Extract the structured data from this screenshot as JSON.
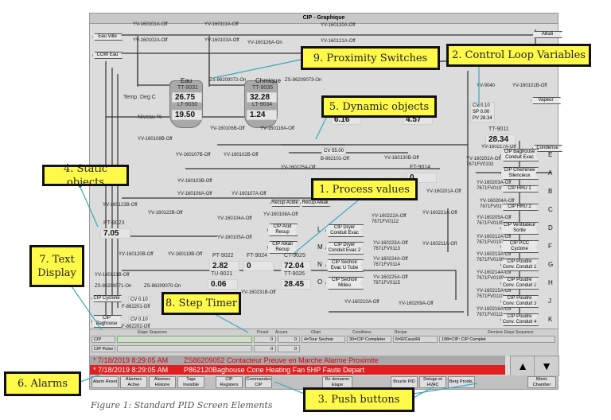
{
  "window": {
    "title": "CIP - Graphique"
  },
  "pipe_labels": [
    "Eau Ville",
    "COW Eau",
    "Alkali",
    "Vapeur",
    "Condense",
    "Recup Acide",
    "Recup Alkali",
    "CIP Acid Recup",
    "CIP Alkali Recup",
    "CIP Cyclone",
    "CIP Baghouse"
  ],
  "tanks": [
    {
      "name": "Eau",
      "temp_tag": "TT-9031",
      "temp": "26.75",
      "level_tag": "LT-9030",
      "level": "19.50"
    },
    {
      "name": "Chmique",
      "temp_tag": "TT-9035",
      "temp": "32.28",
      "level_tag": "LT-9034",
      "level": "1.24"
    }
  ],
  "tank_labels": {
    "temp": "Temp. Deg C",
    "level": "Niveau %"
  },
  "tags": [
    "YV-160101A-Off",
    "YV-160102A-Off",
    "YV-160111A-Off",
    "YV-160103A-Off",
    "YV-160126A-On",
    "YV-160120A-Off",
    "YV-160121A-Off",
    "ZS-86209072-On",
    "ZS-86209073-On",
    "YV-160106B-Off",
    "YV-160116A-Off",
    "YV-160108B-Off",
    "YV-160107B-Off",
    "YV-160102B-Off",
    "YV-160125A-Off",
    "B-862101-Off",
    "YV-160130B-Off",
    "YV-9040",
    "YV-160101B-Off",
    "YV-160217A-Off",
    "YV-160103B-Off",
    "YV-160106A-Off",
    "YV-160107A-Off",
    "YV-160123B-Off",
    "YV-160122B-Off",
    "YV-160108A-Off",
    "YV-160104A-Off",
    "YV-160105A-Off",
    "YV-160201A-Off",
    "YV-160221A-Off",
    "YV-160211A-Off",
    "YV-160120B-Off",
    "YV-160119B-Off",
    "YV-160231B-Off",
    "YV-160121B-Off",
    "ZS-86209071-On",
    "ZS-86209070-On",
    "F-862201-Off",
    "F-862202-Off",
    "YV-160210A-Off",
    "YV-160209A-Off",
    "YV-160222A-Off 7671FV0112",
    "YV-160223A-Off 7671FV0113",
    "YV-160224A-Off 7671FV0114",
    "YV-160225A-Off 7671FV0115",
    "YV-160202A-Off 7671FV0102",
    "YV-160203A-Off 7671FV0103",
    "YV-160204A-Off 7671FV0104",
    "YV-160205A-Off 7671FV0105",
    "YV-160212A-Off 7671FV0107",
    "YV-160213A-Off 7671FV0108",
    "YV-160214A-Off 7671FV0109",
    "YV-160215A-Off 7671FV0110",
    "YV-160216A-Off 7671FV0111"
  ],
  "process_values": [
    {
      "tag": "PT-9012",
      "value": "6.16"
    },
    {
      "tag": "PT-9013",
      "value": "4.57"
    },
    {
      "tag": "FT-9014",
      "value": "0"
    },
    {
      "tag": "TT-9011",
      "value": "28.34"
    },
    {
      "tag": "PT-9023",
      "value": "7.05"
    },
    {
      "tag": "PT-9022",
      "value": "2.82"
    },
    {
      "tag": "FT-9024",
      "value": "0"
    },
    {
      "tag": "CT-9025",
      "value": "72.04"
    },
    {
      "tag": "TU-9021",
      "value": "0.06"
    },
    {
      "tag": "TT-9026",
      "value": "28.45"
    }
  ],
  "control_loops": [
    {
      "lines": [
        "CV 0.10",
        "SP 0.00",
        "PV 28.34"
      ]
    },
    {
      "lines": [
        "CV 55.00"
      ]
    },
    {
      "lines": [
        "CV 0.10"
      ]
    },
    {
      "lines": [
        "CV 0.10"
      ]
    }
  ],
  "left_destinations": [
    {
      "letter": "L",
      "label": "CIP Dryer Conduit Evac"
    },
    {
      "letter": "M",
      "label": "CIP Dryer Conduit Evac 2"
    },
    {
      "letter": "N",
      "label": "CIP Sechoir Evac U Tube"
    },
    {
      "letter": "O",
      "label": "CIP Sechoir Milieu"
    }
  ],
  "right_destinations": [
    {
      "letter": "E",
      "label": "CIP Baghouse Conduit Evac"
    },
    {
      "letter": "A",
      "label": "CIP Cheminee Silencieux"
    },
    {
      "letter": "B",
      "label": "CIP HRU 1"
    },
    {
      "letter": "C",
      "label": "CIP HRU 2"
    },
    {
      "letter": "D",
      "label": "CIP Ventilateur Sortie"
    },
    {
      "letter": "F",
      "label": "CIP PCC Cyclone"
    },
    {
      "letter": "G",
      "label": "CIP Poudre Conv. Conduit 1"
    },
    {
      "letter": "H",
      "label": "CIP Poudre Conv. Conduit 2"
    },
    {
      "letter": "J",
      "label": "CIP Poudre Conv. Conduit 3"
    },
    {
      "letter": "K",
      "label": "CIP Poudre Conv. Conduit 4"
    }
  ],
  "sequence": {
    "headers": [
      "Etape Sequence",
      "Preset",
      "Accum.",
      "Objet",
      "Conditions",
      "Recipe",
      "Derniere Etape Sequence"
    ],
    "rows": [
      {
        "name": "CIP",
        "step": "",
        "preset": "0",
        "accum": "0",
        "objet": "4=Tour Sechoir",
        "conditions": "30=CIP Completer",
        "recipe": "6=R/Caus/Ri",
        "last": "198=CIP: CIP Complet"
      },
      {
        "name": "CIP Pulse",
        "step": "",
        "preset": "0",
        "accum": "0"
      }
    ]
  },
  "alarms": [
    {
      "time": "* 7/18/2019 8:29:05 AM",
      "message": "ZS86209052 Contacteur Preuve en Marche Alarme Proximite",
      "active": false
    },
    {
      "time": "* 7/18/2019 8:29:05 AM",
      "message": "P862120Baghouse Cone Heating Fan 5HP Faute Depart",
      "active": true
    }
  ],
  "scroll": {
    "up": "▲",
    "down": "▼"
  },
  "buttons": [
    "Alarm Reset",
    "Alarmes Active",
    "Alarmes Histoire",
    "Tags Invisible",
    "CIP Registers",
    "Commandes CIP",
    "Re demarrer Etape",
    "Boucle PID",
    "Deluge et HVAC",
    "Berg Prodis.",
    "Mimic Chamber"
  ],
  "callouts": [
    "1. Process values",
    "2. Control Loop Variables",
    "3. Push buttons",
    "4. Static objects",
    "5. Dynamic objects",
    "6. Alarms",
    "7. Text Display",
    "8. Step Timer",
    "9. Proximity Switches"
  ],
  "caption": "Figure 1: Standard PID Screen Elements",
  "colors": {
    "callout": "#fff94a",
    "alarm_active": "#e02020",
    "alarm_text": "#dd0000",
    "arrow": "#3aa7c0",
    "hmi_bg": "#dcdcdc"
  }
}
